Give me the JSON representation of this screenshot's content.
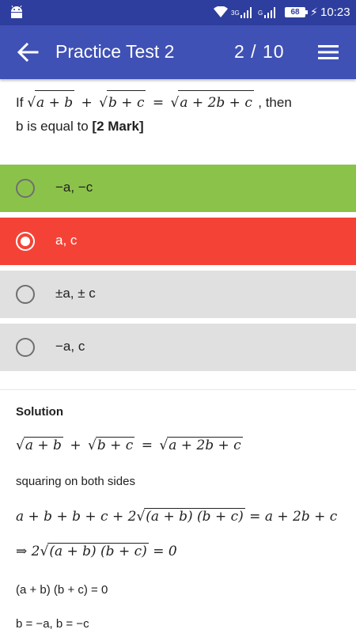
{
  "status_bar": {
    "network_label": "3G",
    "network_label_2": "G",
    "battery": "68",
    "time": "10:23"
  },
  "app_bar": {
    "title": "Practice Test 2",
    "counter": "2  / 10"
  },
  "question": {
    "prefix": "If",
    "lhs_radicand_1": "a + b",
    "plus": "+",
    "lhs_radicand_2": "b + c",
    "equals": "=",
    "rhs_radicand": "a + 2b + c",
    "suffix": ", then",
    "line2": "b is equal to",
    "marks": "[2 Mark]"
  },
  "options": [
    {
      "label": "−a, −c",
      "state": "correct",
      "color": "#8bc34a"
    },
    {
      "label": "a, c",
      "state": "selected-wrong",
      "color": "#f44336"
    },
    {
      "label": "±a, ± c",
      "state": "neutral",
      "color": "#e0e0e0"
    },
    {
      "label": "−a, c",
      "state": "neutral",
      "color": "#e0e0e0"
    }
  ],
  "solution": {
    "heading": "Solution",
    "step1": {
      "r1": "a + b",
      "plus": "+",
      "r2": "b + c",
      "eq": "=",
      "r3": "a + 2b + c"
    },
    "text1": "squaring on both sides",
    "step2": {
      "lead": "a + b + b + c + 2",
      "radicand": "(a + b) (b + c)",
      "rhs": "= a + 2b + c"
    },
    "step3": {
      "arrow": "⇒ 2",
      "radicand": "(a + b) (b + c)",
      "rhs": "= 0"
    },
    "text2": "(a + b) (b + c) = 0",
    "text3": "b = −a, b = −c"
  },
  "colors": {
    "status_bar": "#2e3e9e",
    "app_bar": "#3f51b5",
    "correct": "#8bc34a",
    "wrong": "#f44336",
    "neutral": "#e0e0e0"
  }
}
